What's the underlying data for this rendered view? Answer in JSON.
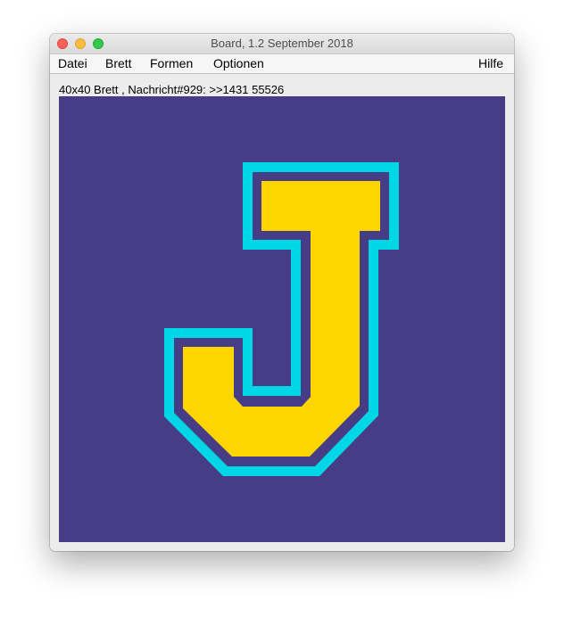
{
  "window": {
    "title": "Board, 1.2 September 2018"
  },
  "menu": {
    "items": [
      "Datei",
      "Brett",
      "Formen",
      "Optionen"
    ],
    "help": "Hilfe"
  },
  "status": {
    "text": "40x40 Brett , Nachricht#929: >>1431 55526"
  },
  "board": {
    "background_color": "#473d87",
    "letter": {
      "shape": "J",
      "outline_color": "#00d7e6",
      "fill_color": "#ffd500"
    }
  }
}
